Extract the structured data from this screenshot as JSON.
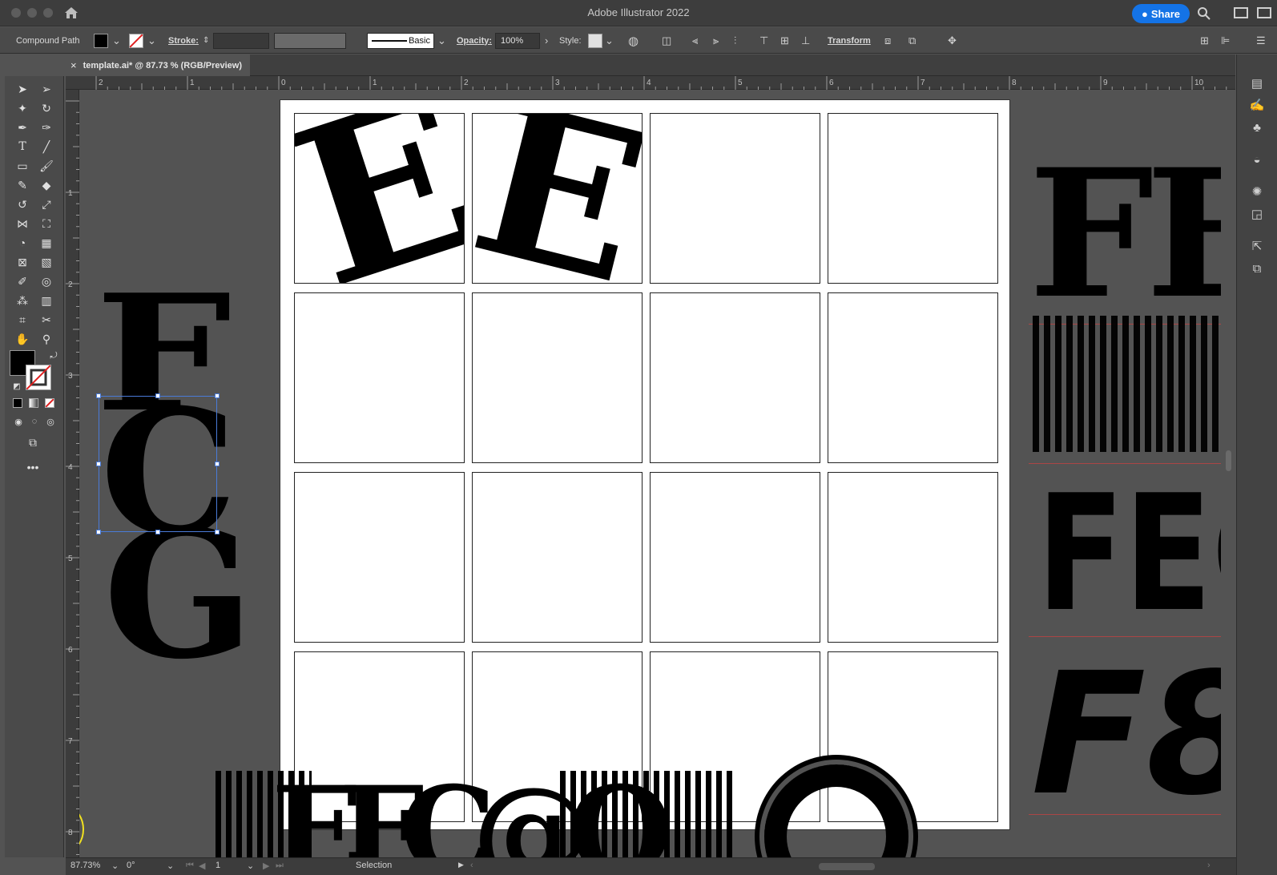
{
  "titlebar": {
    "app_title": "Adobe Illustrator 2022",
    "share_label": "Share"
  },
  "controlbar": {
    "selection_type": "Compound Path",
    "stroke_label": "Stroke:",
    "brush_label": "Basic",
    "opacity_label": "Opacity:",
    "opacity_value": "100%",
    "style_label": "Style:",
    "transform_label": "Transform",
    "fill_color": "#000000"
  },
  "document": {
    "tab_label": "template.ai* @ 87.73 % (RGB/Preview)",
    "close_glyph": "×"
  },
  "rulers": {
    "horizontal": [
      "2",
      "1",
      "0",
      "1",
      "2",
      "3",
      "4",
      "5",
      "6",
      "7",
      "8",
      "9",
      "10"
    ],
    "vertical": [
      "1",
      "2",
      "3",
      "4",
      "5",
      "6",
      "7",
      "8"
    ]
  },
  "artwork": {
    "cell1_letter": "E",
    "cell2_letter": "E",
    "left_stack": [
      "F",
      "C",
      "G"
    ],
    "right_rows": [
      "FE",
      "FE",
      "FEC",
      "F8"
    ],
    "bottom_row": "EFC@O"
  },
  "statusbar": {
    "zoom": "87.73%",
    "rotation": "0°",
    "artboard_number": "1",
    "mode": "Selection"
  },
  "colors": {
    "accent": "#1473e6",
    "selection": "#4a7bd8",
    "cursor_highlight": "#f0e020"
  }
}
